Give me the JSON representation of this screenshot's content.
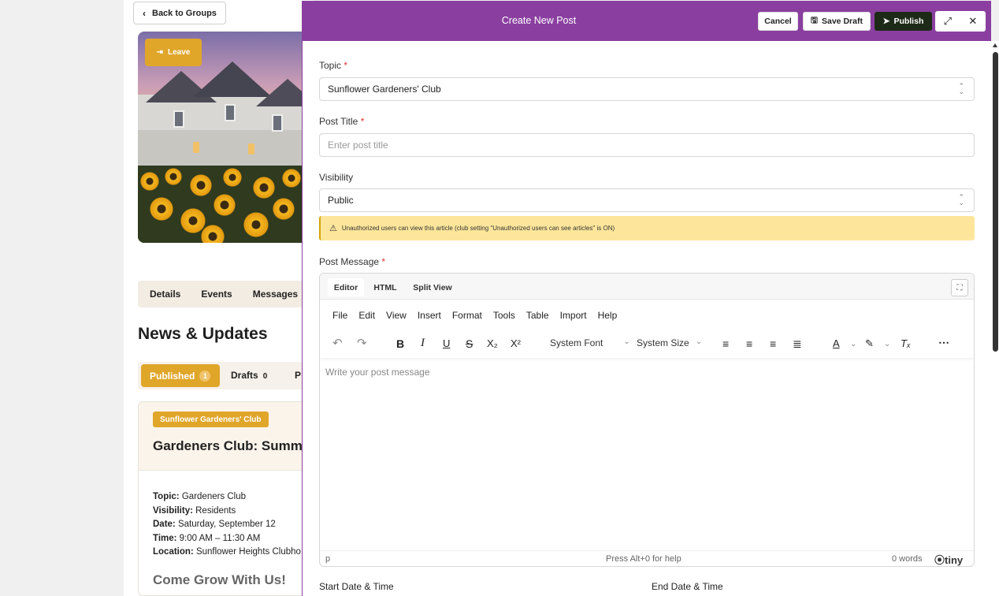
{
  "background": {
    "back_label": "Back to Groups",
    "leave_label": "Leave",
    "tabs": [
      "Details",
      "Events",
      "Messages"
    ],
    "news_title": "News & Updates",
    "published_label": "Published",
    "published_count": "1",
    "drafts_label": "Drafts",
    "drafts_count": "0",
    "third_tab_initial": "P",
    "card": {
      "badge": "Sunflower Gardeners' Club",
      "title": "Gardeners Club: Summ",
      "topic_label": "Topic:",
      "topic_value": " Gardeners Club",
      "visibility_label": "Visibility:",
      "visibility_value": " Residents",
      "date_label": "Date:",
      "date_value": " Saturday, September 12",
      "time_label": "Time:",
      "time_value": " 9:00 AM – 11:30 AM",
      "location_label": "Location:",
      "location_value": " Sunflower Heights Clubho",
      "subheading": "Come Grow With Us!"
    }
  },
  "modal": {
    "title": "Create New Post",
    "cancel_label": "Cancel",
    "save_draft_label": "Save Draft",
    "publish_label": "Publish",
    "accent_color": "#8a3fa0",
    "topic": {
      "label": "Topic",
      "value": "Sunflower Gardeners' Club"
    },
    "post_title": {
      "label": "Post Title",
      "placeholder": "Enter post title"
    },
    "visibility": {
      "label": "Visibility",
      "value": "Public"
    },
    "warning": "Unauthorized users can view this article (club setting \"Unauthorized users can see articles\" is ON)",
    "message_label": "Post Message",
    "editor": {
      "tabs": [
        "Editor",
        "HTML",
        "Split View"
      ],
      "menus": [
        "File",
        "Edit",
        "View",
        "Insert",
        "Format",
        "Tools",
        "Table",
        "Import",
        "Help"
      ],
      "font_label": "System Font",
      "size_label": "System Size",
      "placeholder": "Write your post message",
      "status_path": "p",
      "status_help": "Press Alt+0 for help",
      "word_count": "0 words",
      "brand": "tiny"
    },
    "start_label": "Start Date & Time",
    "end_label": "End Date & Time"
  }
}
